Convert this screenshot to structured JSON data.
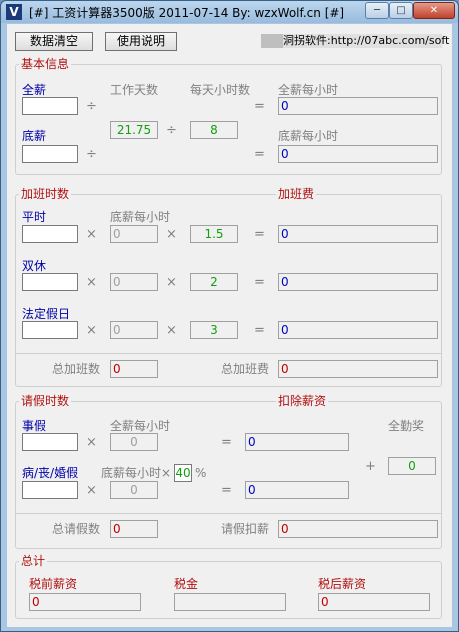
{
  "window": {
    "title": "[#] 工资计算器3500版  2011-07-14  By: wzxWolf.cn [#]",
    "icon_text": "V",
    "icons": [
      "app-icon",
      "minimize-icon",
      "maximize-icon",
      "close-icon"
    ]
  },
  "toolbar": {
    "clear_label": "数据清空",
    "help_label": "使用说明",
    "link_text": "洞拐软件:http://07abc.com/soft"
  },
  "basic": {
    "title": "基本信息",
    "full_salary_label": "全薪",
    "base_salary_label": "底薪",
    "work_days_label": "工作天数",
    "hours_per_day_label": "每天小时数",
    "full_hourly_label": "全薪每小时",
    "base_hourly_label": "底薪每小时",
    "work_days_value": "21.75",
    "hours_value": "8",
    "full_hourly_value": "0",
    "base_hourly_value": "0"
  },
  "overtime": {
    "title": "加班时数",
    "fee_title": "加班费",
    "base_hourly_label": "底薪每小时",
    "rows": [
      {
        "label": "平时",
        "hourly": "0",
        "rate": "1.5",
        "result": "0"
      },
      {
        "label": "双休",
        "hourly": "0",
        "rate": "2",
        "result": "0"
      },
      {
        "label": "法定假日",
        "hourly": "0",
        "rate": "3",
        "result": "0"
      }
    ],
    "total_hours_label": "总加班数",
    "total_hours_value": "0",
    "total_fee_label": "总加班费",
    "total_fee_value": "0"
  },
  "leave": {
    "title": "请假时数",
    "deduct_title": "扣除薪资",
    "personal_label": "事假",
    "full_hourly_label": "全薪每小时",
    "personal_hourly": "0",
    "personal_result": "0",
    "sick_label": "病/丧/婚假",
    "base_hourly_label": "底薪每小时×",
    "sick_percent": "40",
    "percent_sign": "%",
    "sick_hourly": "0",
    "sick_result": "0",
    "bonus_label": "全勤奖",
    "bonus_value": "0",
    "total_hours_label": "总请假数",
    "total_hours_value": "0",
    "total_deduct_label": "请假扣薪",
    "total_deduct_value": "0"
  },
  "summary": {
    "title": "总计",
    "pretax_label": "税前薪资",
    "pretax_value": "0",
    "tax_label": "税金",
    "tax_value": "",
    "aftertax_label": "税后薪资",
    "aftertax_value": "0"
  },
  "ops": {
    "times": "×",
    "divide": "÷",
    "equals": "=",
    "plus": "+"
  }
}
